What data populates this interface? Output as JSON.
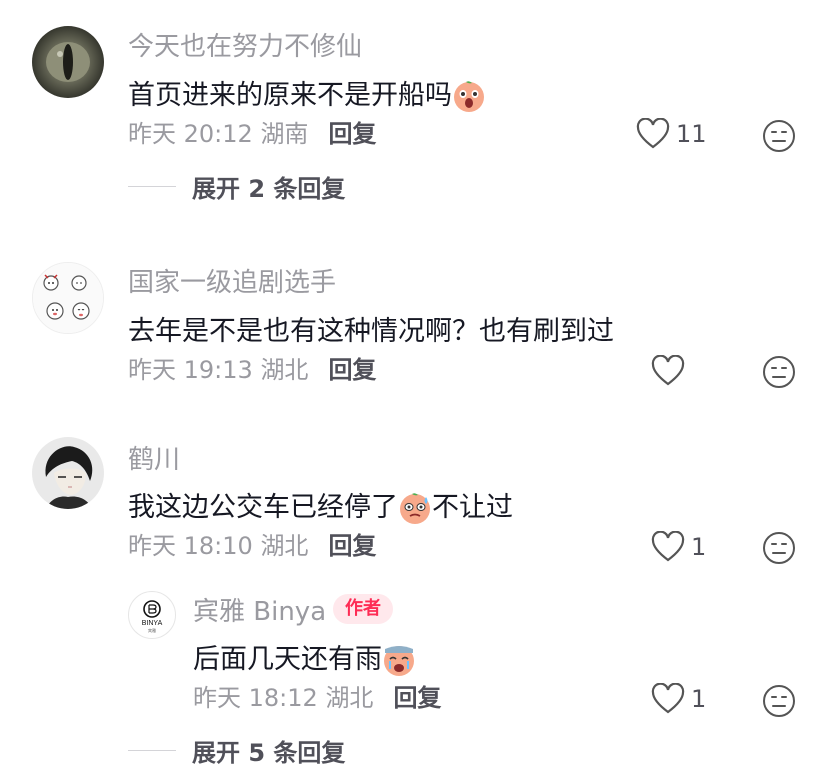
{
  "comments": [
    {
      "username": "今天也在努力不修仙",
      "content_before": "首页进来的原来不是开船吗",
      "content_after": "",
      "emoji": "shocked-emoji",
      "time": "昨天 20:12",
      "location": "湖南",
      "reply_label": "回复",
      "likes": "11",
      "expand_label": "展开 2 条回复"
    },
    {
      "username": "国家一级追剧选手",
      "content_before": "去年是不是也有这种情况啊？也有刷到过",
      "content_after": "",
      "time": "昨天 19:13",
      "location": "湖北",
      "reply_label": "回复",
      "likes": ""
    },
    {
      "username": "鹤川",
      "content_before": "我这边公交车已经停了",
      "content_after": "不让过",
      "emoji": "sweat-emoji",
      "time": "昨天 18:10",
      "location": "湖北",
      "reply_label": "回复",
      "likes": "1",
      "replies": [
        {
          "username": "宾雅 Binya",
          "badge": "作者",
          "avatar_text": "BINYA",
          "avatar_sub": "宾雅",
          "content_before": "后面几天还有雨",
          "content_after": "",
          "emoji": "crying-emoji",
          "time": "昨天 18:12",
          "location": "湖北",
          "reply_label": "回复",
          "likes": "1"
        }
      ],
      "expand_label": "展开 5 条回复"
    }
  ],
  "colors": {
    "username": "#9a9aa0",
    "content": "#161823",
    "badge_bg": "#ffe8ec",
    "badge_text": "#fe2c55"
  }
}
